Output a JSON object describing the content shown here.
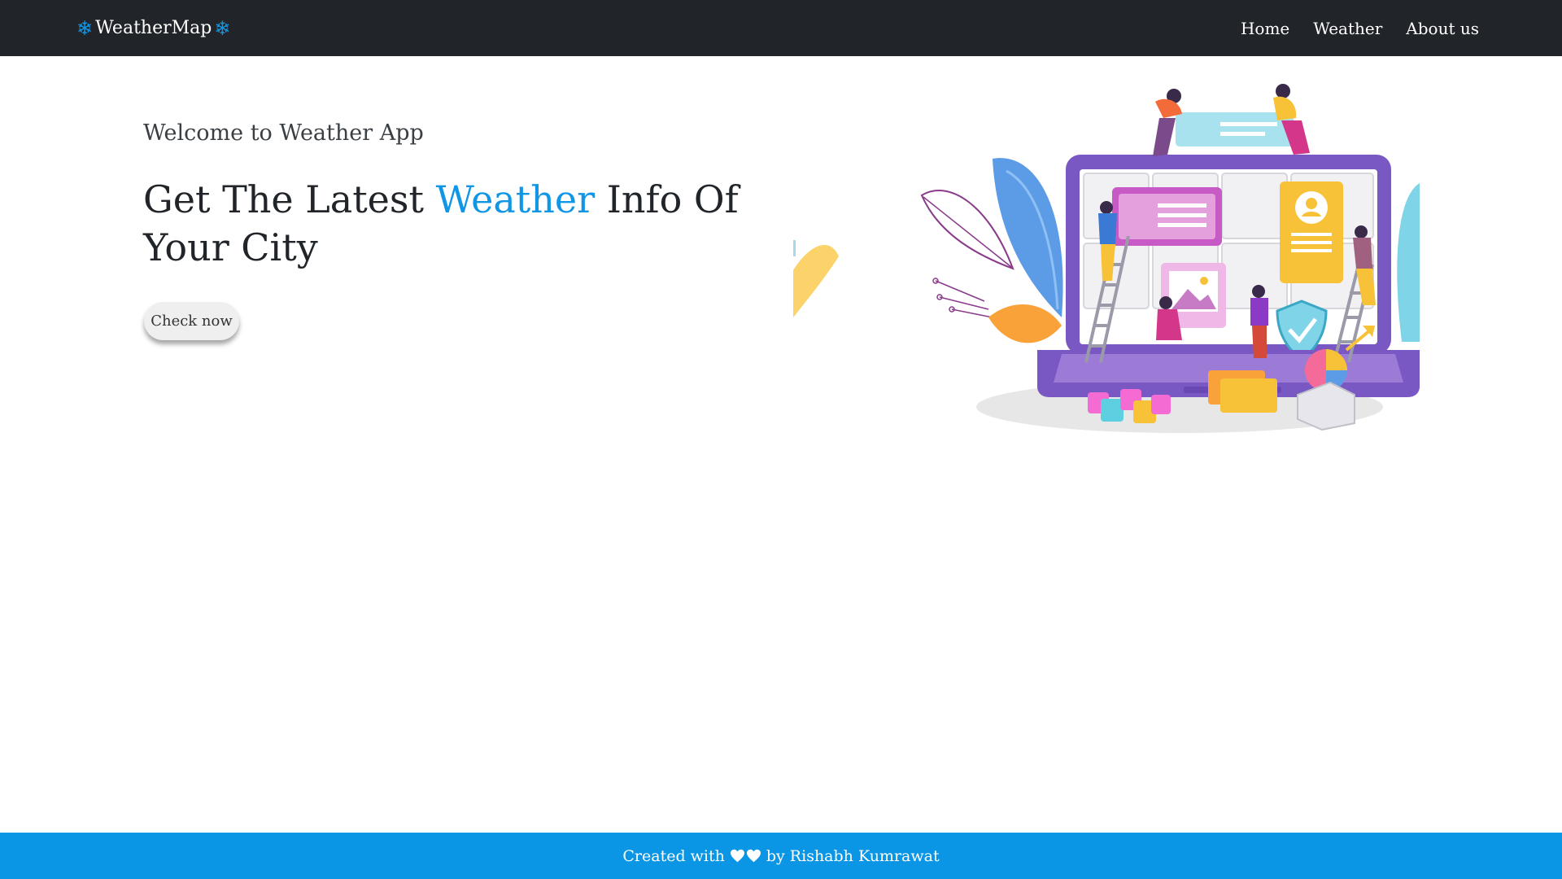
{
  "navbar": {
    "brand": "WeatherMap",
    "brand_icon": "snowflake-icon",
    "links": [
      "Home",
      "Weather",
      "About us"
    ]
  },
  "hero": {
    "welcome": "Welcome to Weather App",
    "headline_before": "Get The Latest ",
    "headline_accent": "Weather",
    "headline_after": " Info Of Your City",
    "cta_label": "Check now",
    "illustration_icon": "laptop-dashboard-illustration"
  },
  "footer": {
    "text_before": "Created with",
    "text_after": "by Rishabh Kumrawat",
    "icon": "heart-icon"
  },
  "colors": {
    "navbar_bg": "#212529",
    "accent": "#1196e6",
    "footer_bg": "#0a96e5"
  }
}
